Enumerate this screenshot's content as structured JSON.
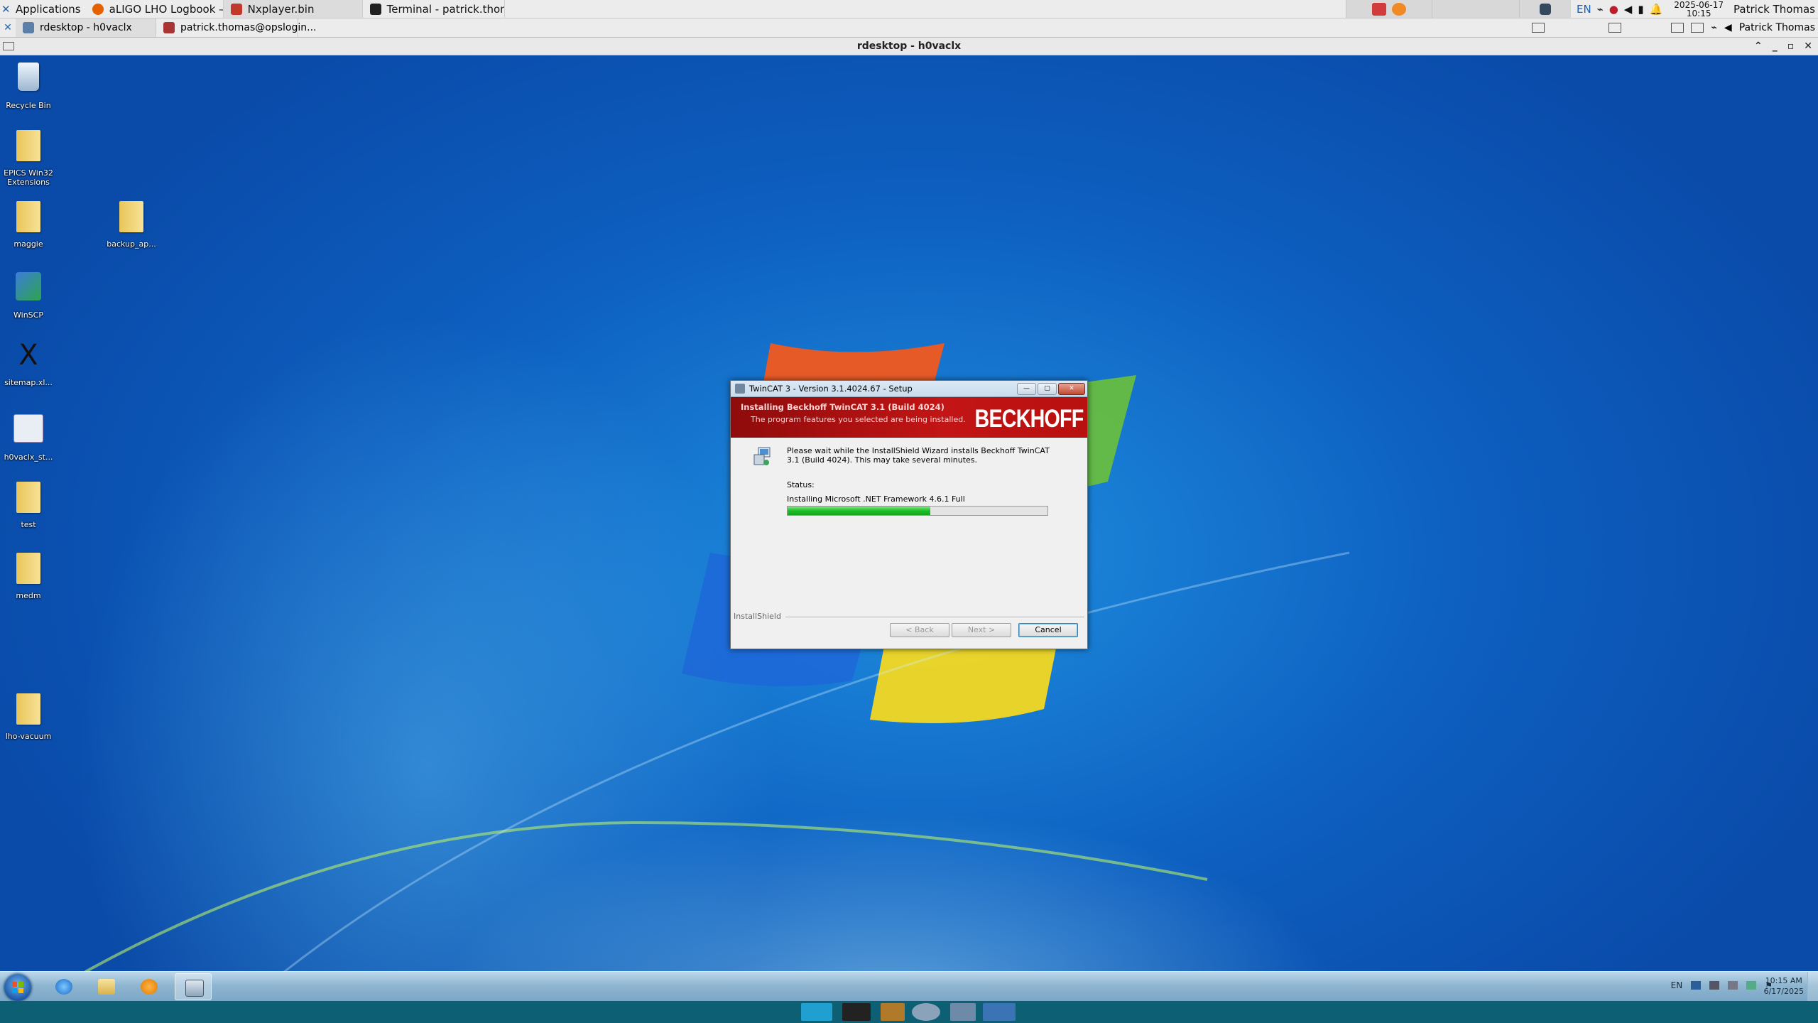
{
  "top_panel": {
    "applications_label": "Applications",
    "tasks": [
      {
        "label": "aLIGO LHO Logbook — ...",
        "icon": "firefox-icon",
        "color": "#e66000"
      },
      {
        "label": "Nxplayer.bin",
        "icon": "nomachine-icon",
        "color": "#c0392b"
      },
      {
        "label": "Terminal - patrick.thom...",
        "icon": "terminal-icon",
        "color": "#222222"
      }
    ],
    "language": "EN",
    "date": "2025-06-17",
    "time": "10:15",
    "user": "Patrick Thomas"
  },
  "second_panel": {
    "tasks": [
      {
        "label": "rdesktop - h0vaclx",
        "icon": "window-icon"
      },
      {
        "label": "patrick.thomas@opslogin...",
        "icon": "terminal-icon"
      }
    ],
    "user": "Patrick Thomas"
  },
  "rdesktop": {
    "title": "rdesktop - h0vaclx"
  },
  "desktop_icons": [
    {
      "label": "Recycle Bin",
      "kind": "bin"
    },
    {
      "label": "EPICS Win32 Extensions",
      "kind": "folder"
    },
    {
      "label": "maggie",
      "kind": "folder"
    },
    {
      "label": "backup_ap...",
      "kind": "folder"
    },
    {
      "label": "WinSCP",
      "kind": "app"
    },
    {
      "label": "sitemap.xl...",
      "kind": "app"
    },
    {
      "label": "h0vaclx_st...",
      "kind": "app"
    },
    {
      "label": "test",
      "kind": "folder"
    },
    {
      "label": "medm",
      "kind": "folder"
    },
    {
      "label": "lho-vacuum",
      "kind": "folder"
    }
  ],
  "dialog": {
    "title": "TwinCAT 3 - Version 3.1.4024.67 - Setup",
    "banner_heading": "Installing Beckhoff TwinCAT 3.1 (Build 4024)",
    "banner_sub": "The program features you selected are being installed.",
    "logo": "BECKHOFF",
    "message": "Please wait while the InstallShield Wizard installs Beckhoff TwinCAT 3.1 (Build 4024). This may take several minutes.",
    "status_label": "Status:",
    "status_text": "Installing Microsoft .NET Framework 4.6.1 Full",
    "progress": 0.55,
    "footer_brand": "InstallShield",
    "back_label": "< Back",
    "next_label": "Next >",
    "cancel_label": "Cancel"
  },
  "win_taskbar": {
    "language": "EN",
    "time": "10:15 AM",
    "date": "6/17/2025"
  }
}
